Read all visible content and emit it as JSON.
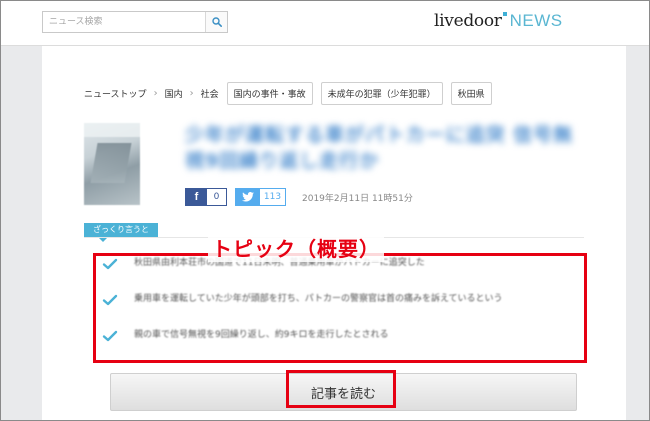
{
  "header": {
    "search": {
      "placeholder": "ニュース検索",
      "icon": "search-icon"
    },
    "logo": {
      "main": "livedoor",
      "news": "NEWS"
    }
  },
  "breadcrumb": {
    "items": [
      "ニューストップ",
      "国内",
      "社会"
    ],
    "separator": "›",
    "tags": [
      "国内の事件・事故",
      "未成年の犯罪（少年犯罪）",
      "秋田県"
    ]
  },
  "article": {
    "headline": "少年が運転する車がパトカーに追突 信号無視9回繰り返し走行か",
    "share": {
      "facebook_count": "0",
      "twitter_count": "113"
    },
    "date": "2019年2月11日 11時51分"
  },
  "summary": {
    "label": "ざっくり言うと",
    "items": [
      "秋田県由利本荘市の国道で11日未明、普通乗用車がパトカーに追突した",
      "乗用車を運転していた少年が頭部を打ち、パトカーの警察官は首の痛みを訴えているという",
      "親の車で信号無視を9回繰り返し、約9キロを走行したとされる"
    ]
  },
  "annotation": {
    "text": "トピック（概要）"
  },
  "read_more": {
    "label": "記事を読む"
  },
  "colors": {
    "accent": "#4bb2d6",
    "annotation_red": "#e60012",
    "facebook": "#3b5998",
    "twitter": "#55acee",
    "headline": "#4f8fd0"
  }
}
